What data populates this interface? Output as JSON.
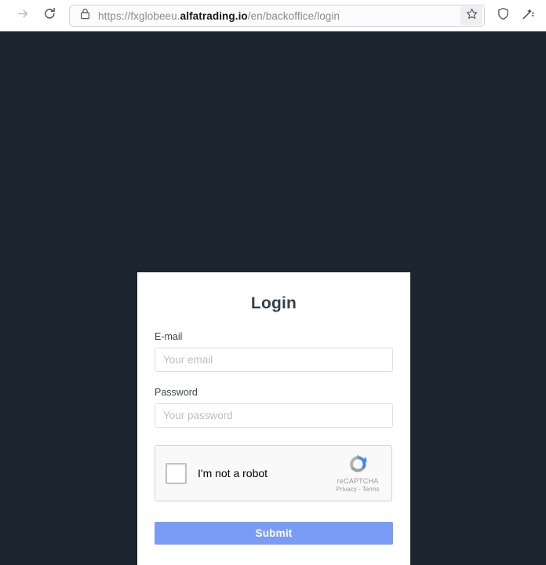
{
  "browser": {
    "forward_icon": "forward-arrow-icon",
    "reload_icon": "reload-icon",
    "lock_icon": "padlock-icon",
    "url_prefix": "https://fxglobeeu.",
    "url_domain": "alfatrading.io",
    "url_suffix": "/en/backoffice/login",
    "bookmark_icon": "star-icon",
    "shield_icon": "shield-icon",
    "sparkle_icon": "sparkle-wand-icon"
  },
  "page": {
    "background_color": "#1c2430"
  },
  "login": {
    "title": "Login",
    "email": {
      "label": "E-mail",
      "placeholder": "Your email",
      "value": ""
    },
    "password": {
      "label": "Password",
      "placeholder": "Your password",
      "value": ""
    },
    "recaptcha": {
      "checkbox_label": "I'm not a robot",
      "brand": "reCAPTCHA",
      "legal": "Privacy - Terms",
      "logo_icon": "recaptcha-circular-arrows-icon",
      "checked": false
    },
    "submit_label": "Submit",
    "submit_color": "#7b9cf5"
  }
}
